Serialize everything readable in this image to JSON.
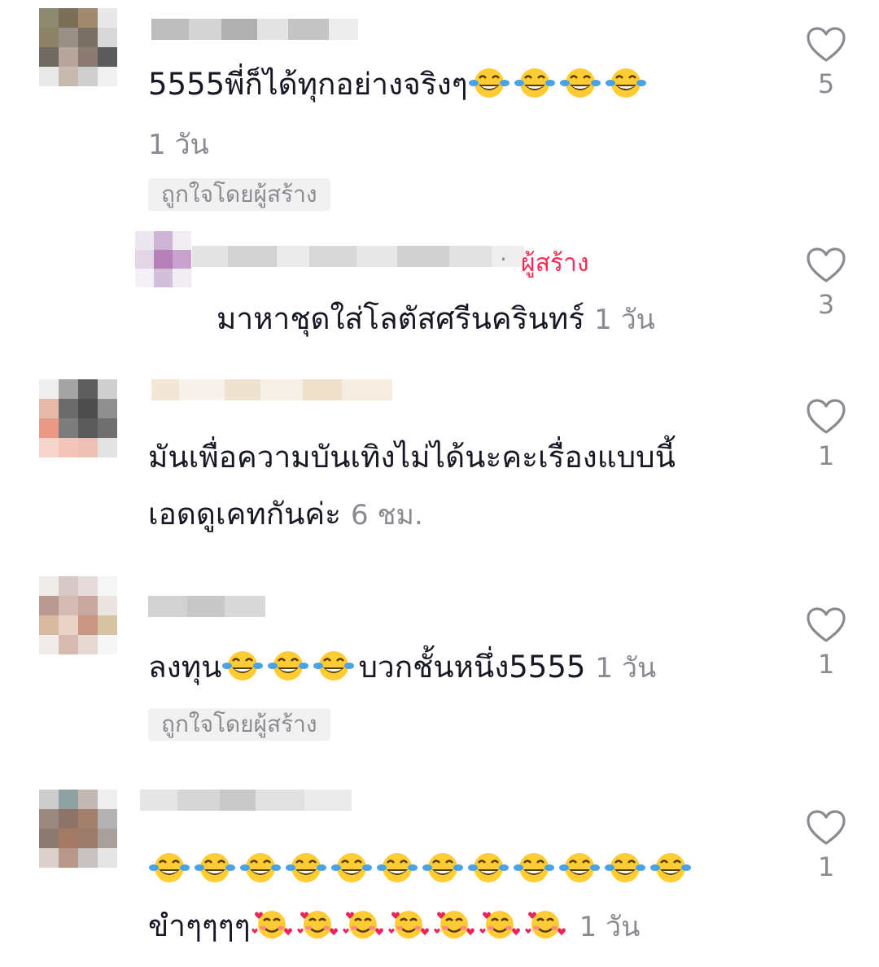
{
  "comments": [
    {
      "text": "5555พี่ก็ได้ทุกอย่างจริงๆ",
      "emoji_count": 4,
      "time": "1 วัน",
      "liked_by_creator": "ถูกใจโดยผู้สร้าง",
      "likes": "5",
      "reply": {
        "creator_label": "ผู้สร้าง",
        "text": "มาหาชุดใส่โลตัสศรีนครินทร์",
        "time": "1 วัน",
        "likes": "3"
      }
    },
    {
      "text_line1": "มันเพื่อความบันเทิงไม่ได้นะคะเรื่องแบบนี้",
      "text_line2": "เอดดูเคทกันค่ะ",
      "time": "6 ชม.",
      "likes": "1"
    },
    {
      "text_before": "ลงทุน",
      "emoji_count": 3,
      "text_after": "บวกชั้นหนึ่ง5555",
      "time": "1 วัน",
      "liked_by_creator": "ถูกใจโดยผู้สร้าง",
      "likes": "1"
    },
    {
      "emoji_count_line1": 12,
      "text_line2": "ขำๆๆๆๆ",
      "emoji_count_line2": 7,
      "time": "1 วัน",
      "likes": "1"
    }
  ],
  "icons": {
    "like": "heart-outline-icon",
    "laugh_emoji": "face-with-tears-of-joy-icon",
    "love_emoji": "smiling-face-with-hearts-icon"
  },
  "colors": {
    "creator_tag": "#fe2c55",
    "secondary_text": "#8a8b91",
    "badge_bg": "#f1f1f2"
  }
}
